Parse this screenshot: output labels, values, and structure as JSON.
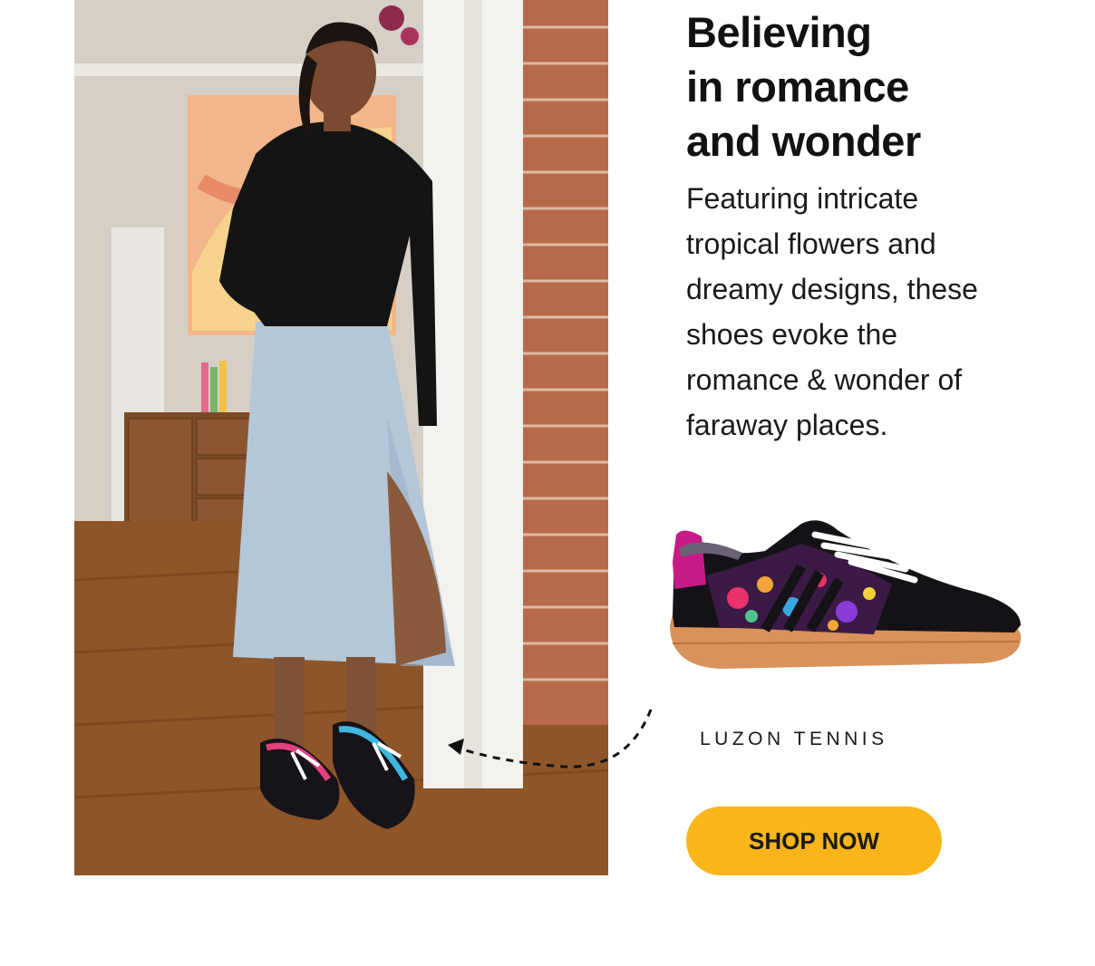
{
  "hero": {
    "title_lines": [
      "Believing",
      "in romance",
      "and wonder"
    ],
    "description": "Featuring intricate tropical flowers and dreamy designs, these shoes evoke the romance & wonder of faraway places."
  },
  "product": {
    "name": "LUZON TENNIS",
    "cta_label": "SHOP NOW"
  },
  "colors": {
    "accent": "#f9b51a",
    "text": "#111111",
    "background": "#ffffff"
  },
  "images": {
    "lifestyle_photo": "woman-wearing-floral-sneakers-photo",
    "product_photo": "luzon-tennis-sneaker-photo"
  }
}
